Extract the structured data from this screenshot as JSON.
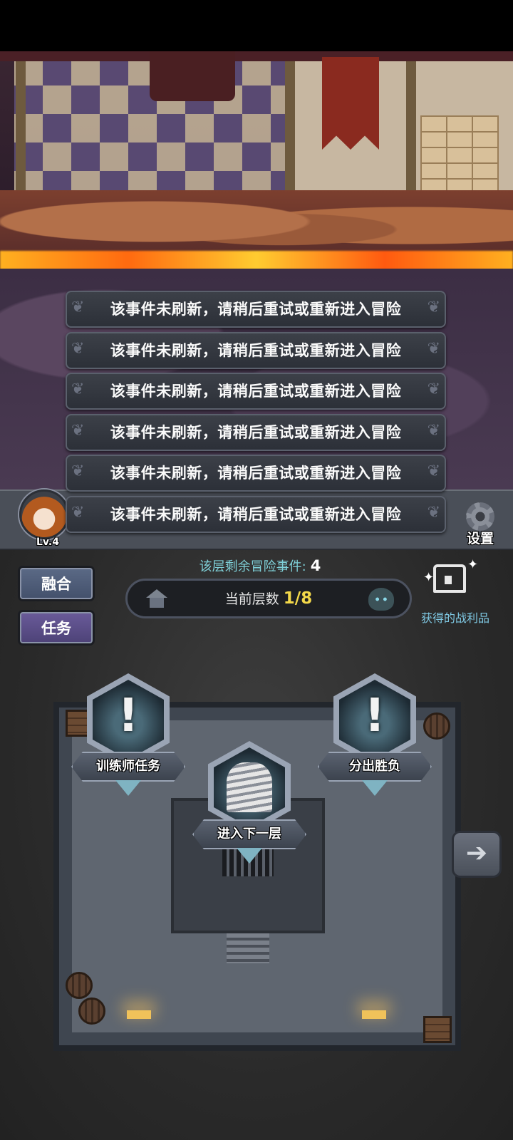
{
  "hud": {
    "level": "Lv.4",
    "settings_label": "设置"
  },
  "toasts": [
    "该事件未刷新，请稍后重试或重新进入冒险",
    "该事件未刷新，请稍后重试或重新进入冒险",
    "该事件未刷新，请稍后重试或重新进入冒险",
    "该事件未刷新，请稍后重试或重新进入冒险",
    "该事件未刷新，请稍后重试或重新进入冒险",
    "该事件未刷新，请稍后重试或重新进入冒险"
  ],
  "side_buttons": {
    "fusion": "融合",
    "task": "任务"
  },
  "floor_info": {
    "remaining_label": "该层剩余冒险事件:",
    "remaining_count": "4",
    "current_floor_label": "当前层数",
    "current_floor_value": "1/8"
  },
  "loot": {
    "label": "获得的战利品",
    "icon": "treasure-chest-icon"
  },
  "map_nodes": {
    "trainer_task": "训练师任务",
    "next_floor": "进入下一层",
    "decide_winner": "分出胜负"
  },
  "icons": {
    "next_room": "arrow-right-icon",
    "floor_start": "house-icon",
    "floor_boss": "demon-head-icon",
    "settings": "gear-icon"
  },
  "colors": {
    "accent_cyan": "#7fd0d8",
    "floor_highlight": "#f4d94a",
    "fusion_button": "#5b6a86",
    "task_button": "#6a5b9a"
  }
}
